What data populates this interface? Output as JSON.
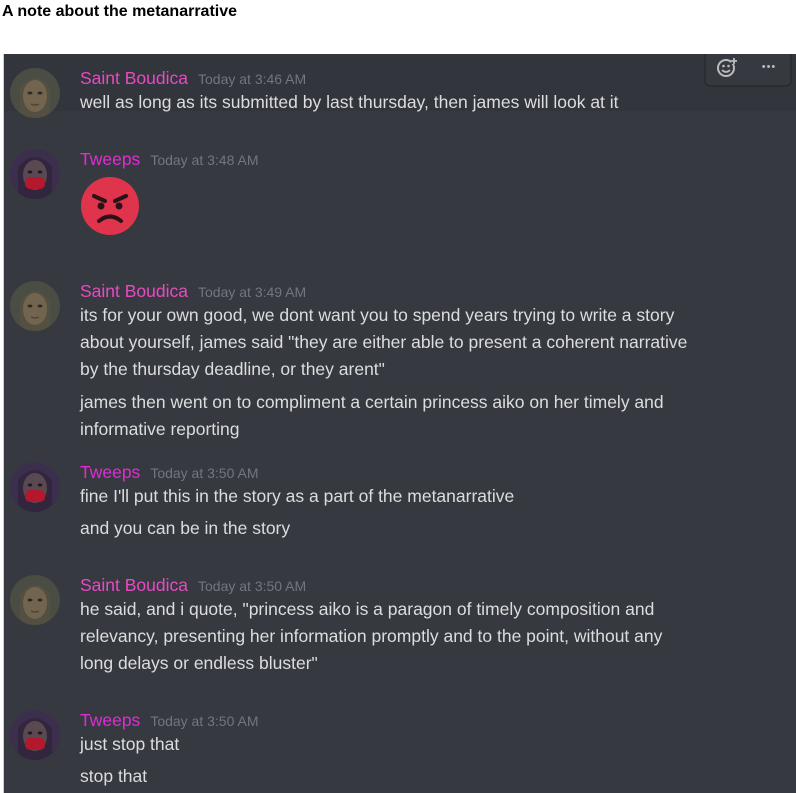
{
  "page": {
    "title": "A note about the metanarrative"
  },
  "colors": {
    "background": "#36393f",
    "saint_boudica": "#e84ac3",
    "tweeps": "#e22bd6",
    "text": "#dcddde",
    "timestamp": "#72767d"
  },
  "toolbar": {
    "add_reaction_icon": "add-reaction-icon",
    "more_icon": "more-icon",
    "more_label": "•••"
  },
  "messages": [
    {
      "author": "Saint Boudica",
      "timestamp": "Today at 3:46 AM",
      "lines": [
        "well as long as its submitted by last thursday, then james will look at it"
      ]
    },
    {
      "author": "Tweeps",
      "timestamp": "Today at 3:48 AM",
      "emoji": "angry-face-emoji",
      "lines": []
    },
    {
      "author": "Saint Boudica",
      "timestamp": "Today at 3:49 AM",
      "lines": [
        "its for your own good, we dont want you to spend years trying to write a story",
        "about yourself, james said \"they are either able to present a coherent narrative",
        "by the thursday deadline, or they arent\"",
        "james then went on to compliment a certain princess aiko on her timely and",
        "informative reporting"
      ]
    },
    {
      "author": "Tweeps",
      "timestamp": "Today at 3:50 AM",
      "lines": [
        "fine I'll put this in the story as a part of the metanarrative",
        "and you can be in the story"
      ]
    },
    {
      "author": "Saint Boudica",
      "timestamp": "Today at 3:50 AM",
      "lines": [
        "he said, and i quote, \"princess aiko is a paragon of timely composition and",
        "relevancy, presenting her information promptly and to the point, without any",
        "long delays or endless bluster\""
      ]
    },
    {
      "author": "Tweeps",
      "timestamp": "Today at 3:50 AM",
      "lines": [
        "just stop that",
        "stop that"
      ]
    }
  ]
}
